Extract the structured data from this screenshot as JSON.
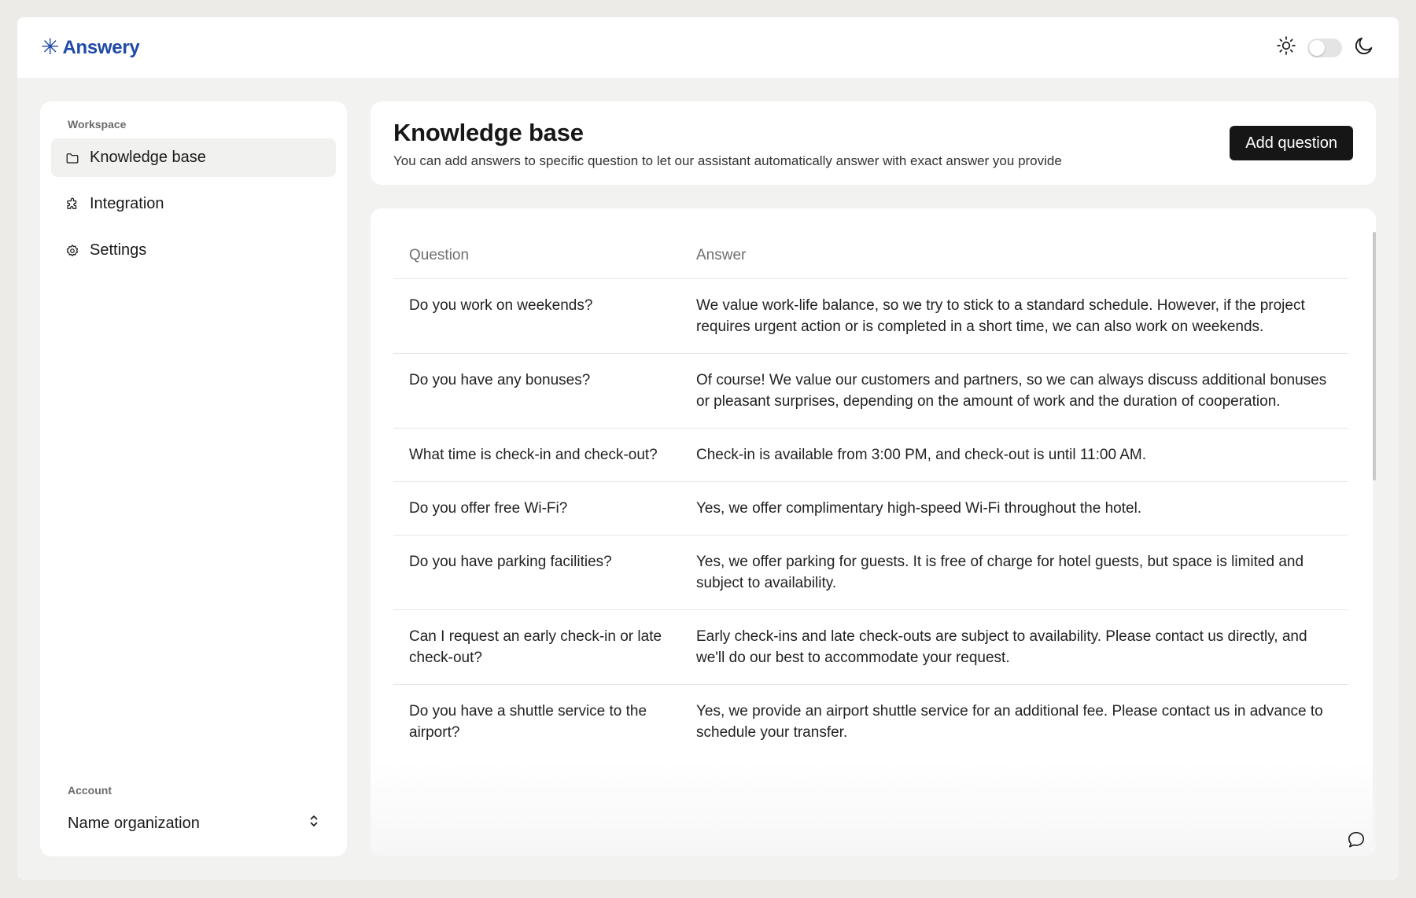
{
  "brand": {
    "mark": "✳",
    "name": "Answery"
  },
  "sidebar": {
    "workspace_label": "Workspace",
    "items": [
      {
        "label": "Knowledge base",
        "icon": "folder-icon",
        "active": true
      },
      {
        "label": "Integration",
        "icon": "puzzle-icon",
        "active": false
      },
      {
        "label": "Settings",
        "icon": "gear-icon",
        "active": false
      }
    ],
    "account_label": "Account",
    "organization": "Name organization"
  },
  "header": {
    "title": "Knowledge base",
    "subtitle": "You can add answers to specific question to let our assistant automatically answer with exact answer you provide",
    "add_button": "Add question"
  },
  "table": {
    "columns": [
      "Question",
      "Answer"
    ],
    "rows": [
      {
        "question": "Do you work on weekends?",
        "answer": "We value work-life balance, so we try to stick to a standard schedule. However, if the project requires urgent action or is completed in a short time, we can also work on weekends."
      },
      {
        "question": "Do you have any bonuses?",
        "answer": "Of course! We value our customers and partners, so we can always discuss additional bonuses or pleasant surprises, depending on the amount of work and the duration of cooperation."
      },
      {
        "question": "What time is check-in and check-out?",
        "answer": "Check-in is available from 3:00 PM, and check-out is until 11:00 AM."
      },
      {
        "question": "Do you offer free Wi-Fi?",
        "answer": "Yes, we offer complimentary high-speed Wi-Fi throughout the hotel."
      },
      {
        "question": "Do you have parking facilities?",
        "answer": "Yes, we offer parking for guests. It is free of charge for hotel guests, but space is limited and subject to availability."
      },
      {
        "question": "Can I request an early check-in or late check-out?",
        "answer": "Early check-ins and late check-outs are subject to availability. Please contact us directly, and we'll do our best to accommodate your request."
      },
      {
        "question": "Do you have a shuttle service to the airport?",
        "answer": "Yes, we provide an airport shuttle service for an additional fee. Please contact us in advance to schedule your transfer."
      }
    ]
  },
  "theme": {
    "light_icon": "sun-icon",
    "dark_icon": "moon-icon",
    "dark_mode": false
  },
  "colors": {
    "brand": "#1f4aa8",
    "button": "#161616",
    "background": "#f2f2f1"
  }
}
